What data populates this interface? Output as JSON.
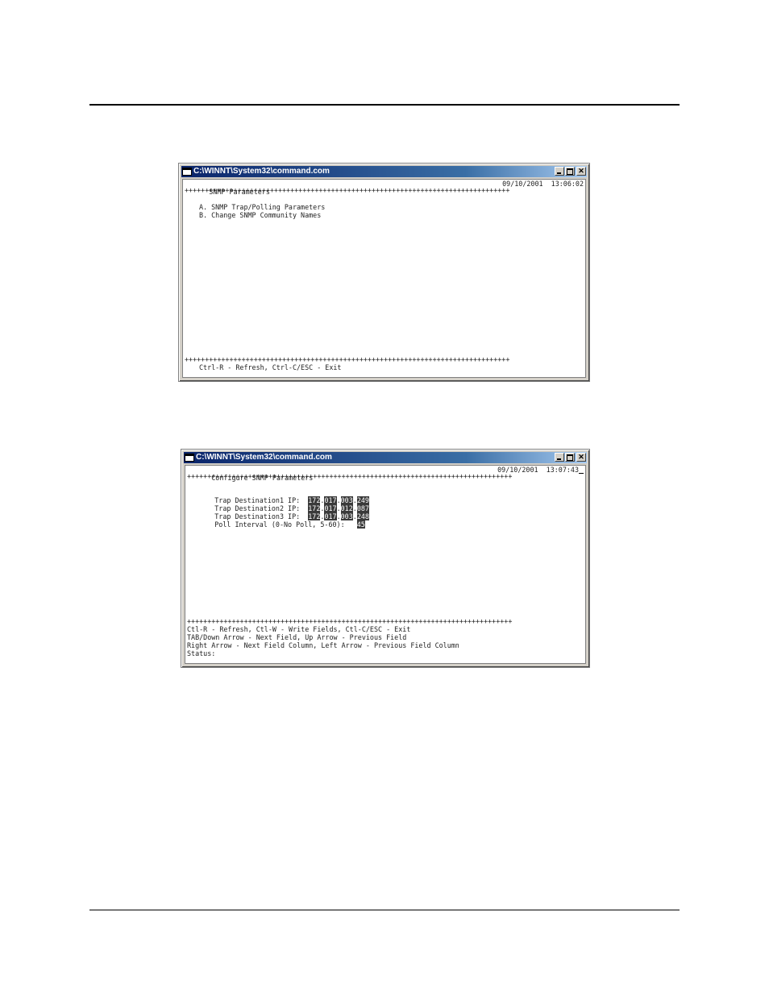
{
  "window1": {
    "title": "C:\\WINNT\\System32\\command.com",
    "screen_title": "SNMP Parameters",
    "date": "09/10/2001",
    "time": "13:06:02",
    "separator": "++++++++++++++++++++++++++++++++++++++++++++++++++++++++++++++++++++++++++++++++",
    "menu_items": [
      "A. SNMP Trap/Polling Parameters",
      "B. Change SNMP Community Names"
    ],
    "footer": "Ctrl-R - Refresh, Ctrl-C/ESC - Exit"
  },
  "window2": {
    "title": "C:\\WINNT\\System32\\command.com",
    "screen_title": "Configure SNMP Parameters",
    "date": "09/10/2001",
    "time": "13:07:43",
    "separator": "++++++++++++++++++++++++++++++++++++++++++++++++++++++++++++++++++++++++++++++++",
    "fields": [
      {
        "label": "Trap Destination1 IP:",
        "octets": [
          "172",
          "017",
          "003",
          "249"
        ]
      },
      {
        "label": "Trap Destination2 IP:",
        "octets": [
          "172",
          "017",
          "012",
          "087"
        ]
      },
      {
        "label": "Trap Destination3 IP:",
        "octets": [
          "172",
          "017",
          "003",
          "248"
        ]
      }
    ],
    "poll_label": "Poll Interval (0-No Poll, 5-60):",
    "poll_value": "45",
    "help_lines": [
      "Ctl-R - Refresh, Ctl-W - Write Fields, Ctl-C/ESC - Exit",
      "TAB/Down Arrow - Next Field, Up Arrow - Previous Field",
      "Right Arrow - Next Field Column, Left Arrow - Previous Field Column"
    ],
    "status_label": "Status:"
  }
}
